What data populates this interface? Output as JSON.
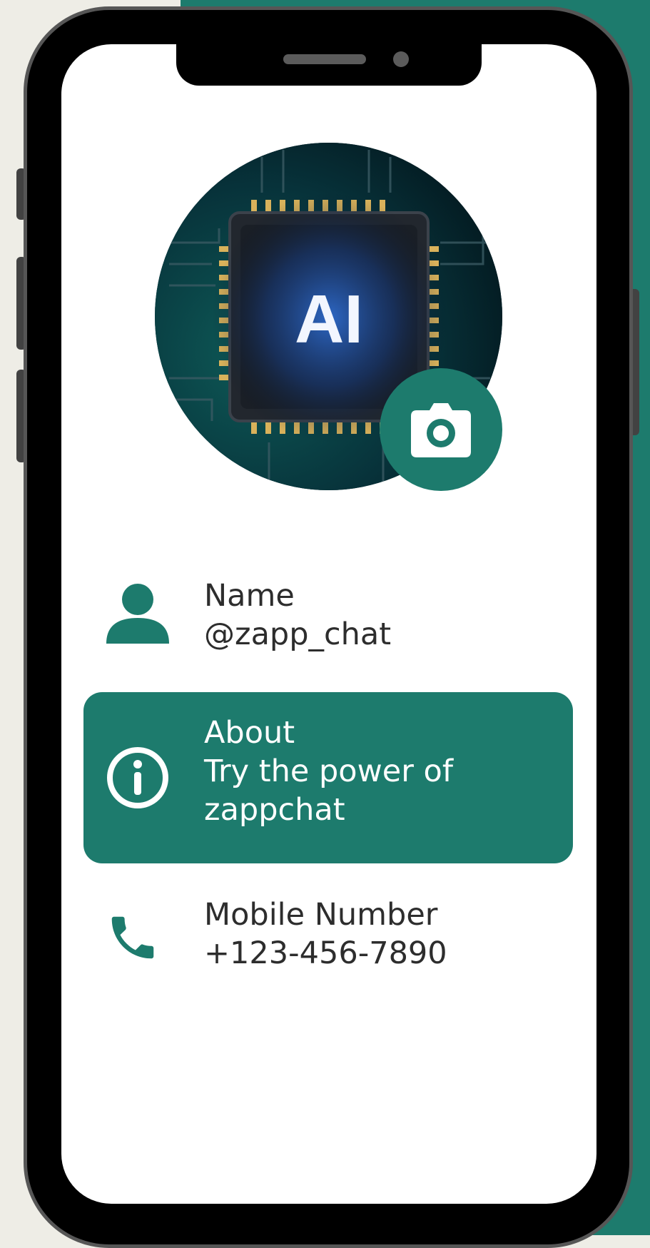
{
  "colors": {
    "accent": "#1d7b6d",
    "background": "#eeede6",
    "text": "#2d2d2d",
    "screen": "#ffffff"
  },
  "profile": {
    "avatar_text": "AI",
    "camera_icon": "camera-icon"
  },
  "fields": {
    "name": {
      "label": "Name",
      "value": "@zapp_chat",
      "icon": "person-icon"
    },
    "about": {
      "label": "About",
      "value": "Try the power of zappchat",
      "icon": "info-icon"
    },
    "mobile": {
      "label": "Mobile Number",
      "value": "+123-456-7890",
      "icon": "phone-icon"
    }
  }
}
